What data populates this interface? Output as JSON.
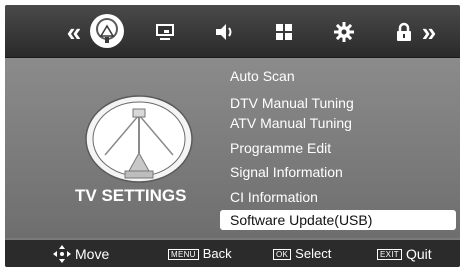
{
  "tabs": [
    {
      "name": "prev-arrow",
      "icon": "double-left-chevron-icon",
      "glyph": "«"
    },
    {
      "name": "tv-settings",
      "icon": "satellite-dish-icon",
      "active": true
    },
    {
      "name": "picture",
      "icon": "picture-monitor-icon"
    },
    {
      "name": "sound",
      "icon": "speaker-icon"
    },
    {
      "name": "apps",
      "icon": "grid-icon"
    },
    {
      "name": "settings",
      "icon": "gear-icon"
    },
    {
      "name": "lock",
      "icon": "lock-icon"
    },
    {
      "name": "next-arrow",
      "icon": "double-right-chevron-icon",
      "glyph": "»"
    }
  ],
  "section_title": "TV SETTINGS",
  "menu": {
    "items": [
      {
        "label": "Auto Scan"
      },
      {
        "label": "DTV Manual Tuning"
      },
      {
        "label": "ATV Manual Tuning"
      },
      {
        "label": "Programme Edit"
      },
      {
        "label": "Signal Information"
      },
      {
        "label": "CI Information"
      },
      {
        "label": "Software Update(USB)",
        "selected": true
      }
    ]
  },
  "footer": {
    "move_label": "Move",
    "menu_key": "MENU",
    "back_label": "Back",
    "ok_key": "OK",
    "select_label": "Select",
    "exit_key": "EXIT",
    "quit_label": "Quit"
  },
  "colors": {
    "selected_bg": "#ffffff",
    "menu_text": "#ffffff",
    "topbar": "#2f2f2f",
    "footer": "#2b2b2b"
  }
}
